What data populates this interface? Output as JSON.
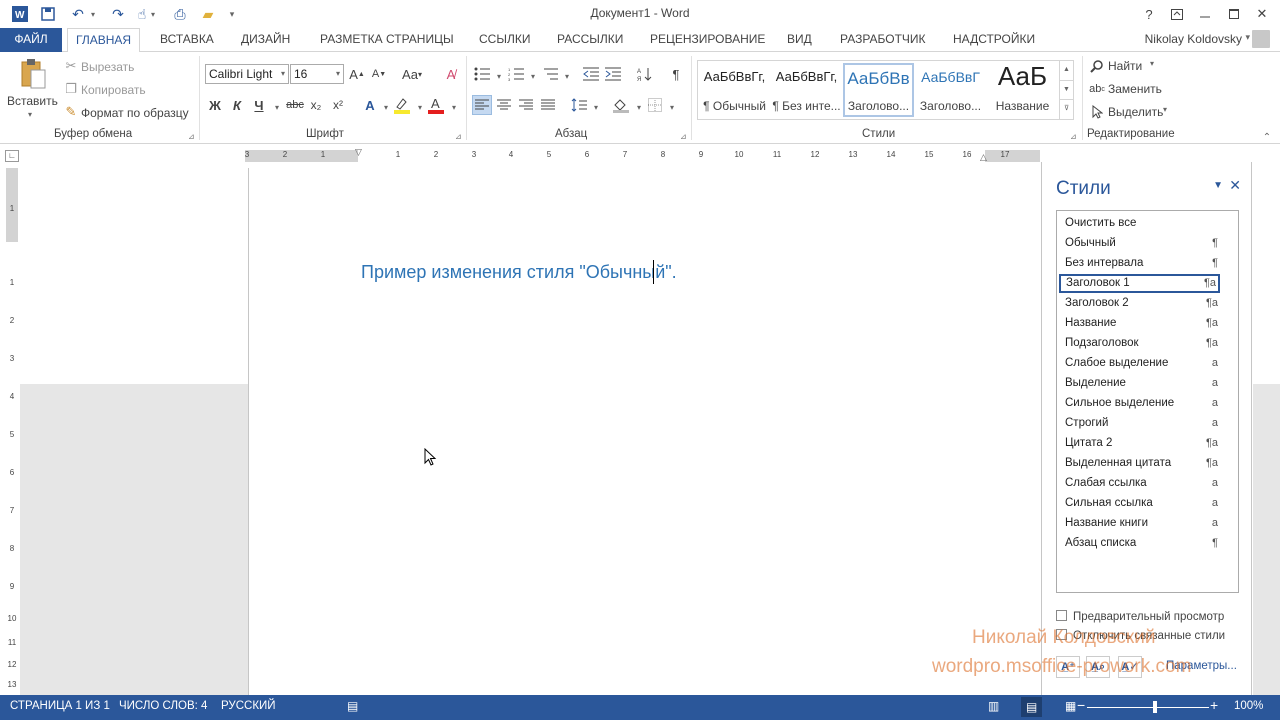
{
  "titlebar": {
    "doc_title": "Документ1 - Word",
    "help": "?",
    "icons": [
      "word-app-icon",
      "save-icon",
      "undo-icon",
      "redo-icon",
      "touch-mode-icon",
      "print-preview-icon",
      "open-icon",
      "customize-qat-icon"
    ]
  },
  "tabs": {
    "file": "ФАЙЛ",
    "home": "ГЛАВНАЯ",
    "insert": "ВСТАВКА",
    "design": "ДИЗАЙН",
    "layout": "РАЗМЕТКА СТРАНИЦЫ",
    "references": "ССЫЛКИ",
    "mailings": "РАССЫЛКИ",
    "review": "РЕЦЕНЗИРОВАНИЕ",
    "view": "ВИД",
    "developer": "РАЗРАБОТЧИК",
    "addins": "НАДСТРОЙКИ",
    "user": "Nikolay Koldovsky"
  },
  "ribbon": {
    "clipboard": {
      "label": "Буфер обмена",
      "paste": "Вставить",
      "cut": "Вырезать",
      "copy": "Копировать",
      "format_painter": "Формат по образцу"
    },
    "font": {
      "label": "Шрифт",
      "font_name": "Calibri Light",
      "font_size": "16",
      "bold": "Ж",
      "italic": "К",
      "underline": "Ч",
      "strike": "abc",
      "subscript": "x₂",
      "superscript": "x²",
      "change_case": "Aa"
    },
    "paragraph": {
      "label": "Абзац"
    },
    "styles": {
      "label": "Стили",
      "items": [
        {
          "sample": "АаБбВвГг,",
          "name": "¶ Обычный"
        },
        {
          "sample": "АаБбВвГг,",
          "name": "¶ Без инте..."
        },
        {
          "sample": "АаБбВв",
          "name": "Заголово..."
        },
        {
          "sample": "АаБбВвГ",
          "name": "Заголово..."
        },
        {
          "sample": "АаБ",
          "name": "Название"
        }
      ]
    },
    "editing": {
      "label": "Редактирование",
      "find": "Найти",
      "replace": "Заменить",
      "select": "Выделить"
    }
  },
  "ruler": {
    "h_numbers": [
      "3",
      "2",
      "1",
      "1",
      "2",
      "3",
      "4",
      "5",
      "6",
      "7",
      "8",
      "9",
      "10",
      "11",
      "12",
      "13",
      "14",
      "15",
      "16",
      "17"
    ],
    "v_numbers": [
      "1",
      "1",
      "2",
      "3",
      "4",
      "5",
      "6",
      "7",
      "8",
      "9",
      "10",
      "11",
      "12",
      "13"
    ]
  },
  "document": {
    "text": "Пример изменения стиля \"Обычный\"."
  },
  "styles_pane": {
    "title": "Стили",
    "items": [
      {
        "name": "Очистить все",
        "mark": ""
      },
      {
        "name": "Обычный",
        "mark": "¶"
      },
      {
        "name": "Без интервала",
        "mark": "¶"
      },
      {
        "name": "Заголовок 1",
        "mark": "¶a"
      },
      {
        "name": "Заголовок 2",
        "mark": "¶a"
      },
      {
        "name": "Название",
        "mark": "¶a"
      },
      {
        "name": "Подзаголовок",
        "mark": "¶a"
      },
      {
        "name": "Слабое выделение",
        "mark": "a"
      },
      {
        "name": "Выделение",
        "mark": "a"
      },
      {
        "name": "Сильное выделение",
        "mark": "a"
      },
      {
        "name": "Строгий",
        "mark": "a"
      },
      {
        "name": "Цитата 2",
        "mark": "¶a"
      },
      {
        "name": "Выделенная цитата",
        "mark": "¶a"
      },
      {
        "name": "Слабая ссылка",
        "mark": "a"
      },
      {
        "name": "Сильная ссылка",
        "mark": "a"
      },
      {
        "name": "Название книги",
        "mark": "a"
      },
      {
        "name": "Абзац списка",
        "mark": "¶"
      }
    ],
    "selected_index": 3,
    "preview_label": "Предварительный просмотр",
    "linked_label": "Отключить связанные стили",
    "params_label": "Параметры..."
  },
  "watermark": {
    "line1": "Николай Колдовский",
    "line2": "wordpro.msoffice-prowork.com"
  },
  "statusbar": {
    "page": "СТРАНИЦА 1 ИЗ 1",
    "words": "ЧИСЛО СЛОВ: 4",
    "language": "РУССКИЙ",
    "zoom": "100%",
    "zoom_level_percent": 100
  },
  "colors": {
    "accent": "#2b579a",
    "heading_text": "#2e74b5",
    "watermark": "#dc6e28"
  }
}
